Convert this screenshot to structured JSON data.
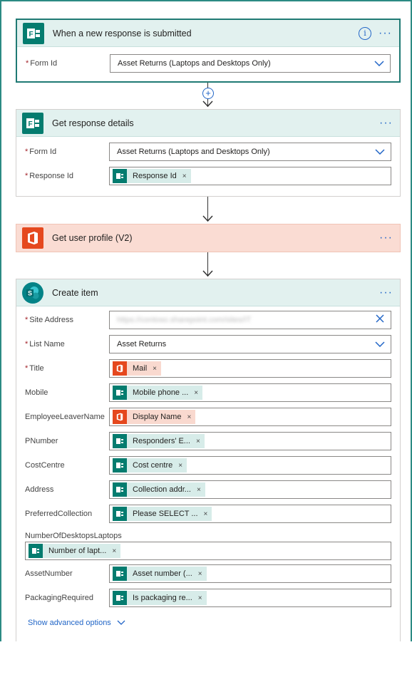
{
  "trigger": {
    "title": "When a new response is submitted",
    "more": "···",
    "info": "i",
    "form_id_label": "Form Id",
    "form_id_value": "Asset Returns (Laptops and Desktops Only)"
  },
  "get_details": {
    "title": "Get response details",
    "more": "···",
    "form_id_label": "Form Id",
    "form_id_value": "Asset Returns (Laptops and Desktops Only)",
    "response_id_label": "Response Id",
    "response_id_token": "Response Id"
  },
  "get_profile": {
    "title": "Get user profile (V2)",
    "more": "···"
  },
  "create_item": {
    "title": "Create item",
    "more": "···",
    "site_address_label": "Site Address",
    "site_address_value": "https://contoso.sharepoint.com/sites/IT",
    "list_name_label": "List Name",
    "list_name_value": "Asset Returns",
    "title_label": "Title",
    "title_token": "Mail",
    "mobile_label": "Mobile",
    "mobile_token": "Mobile phone ...",
    "leaver_label": "EmployeeLeaverName",
    "leaver_token": "Display Name",
    "pnumber_label": "PNumber",
    "pnumber_token": "Responders' E...",
    "costcentre_label": "CostCentre",
    "costcentre_token": "Cost centre",
    "address_label": "Address",
    "address_token": "Collection addr...",
    "preferred_label": "PreferredCollection",
    "preferred_token": "Please SELECT ...",
    "number_label": "NumberOfDesktopsLaptops",
    "number_token": "Number of lapt...",
    "asset_label": "AssetNumber",
    "asset_token": "Asset number (...",
    "packaging_label": "PackagingRequired",
    "packaging_token": "Is packaging re...",
    "advanced": "Show advanced options"
  },
  "token_remove": "×",
  "icons": {
    "forms": "forms-icon",
    "office": "office-icon",
    "sharepoint": "sharepoint-icon"
  },
  "colors": {
    "accent": "#2266c7",
    "forms": "#047c6f",
    "office": "#e5481e",
    "required": "#a4262c"
  }
}
